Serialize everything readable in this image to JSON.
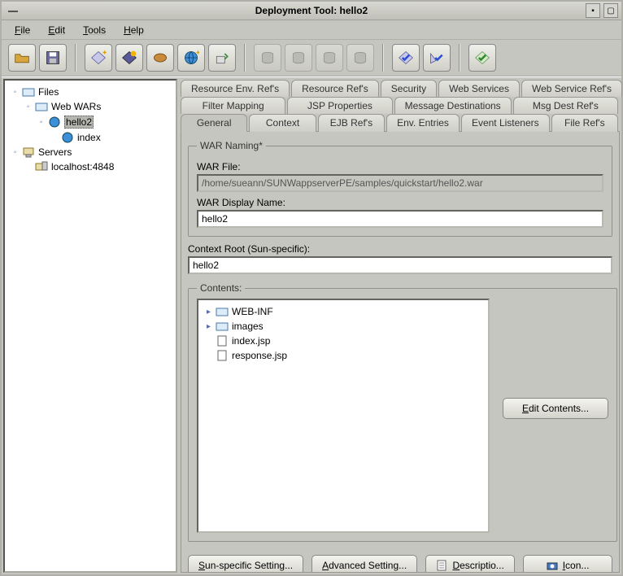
{
  "window": {
    "title": "Deployment Tool: hello2"
  },
  "menubar": {
    "items": [
      "File",
      "Edit",
      "Tools",
      "Help"
    ]
  },
  "toolbar": {
    "icons": [
      "open",
      "save",
      "add-simple",
      "add-sun",
      "bean",
      "globe-new",
      "retrieve",
      "db-box1",
      "db-box2",
      "db-box3",
      "db-box4",
      "check-blue1",
      "check-blue2",
      "check-green"
    ]
  },
  "tree": {
    "files": {
      "label": "Files",
      "web_wars": {
        "label": "Web WARs",
        "hello2": {
          "label": "hello2",
          "index": "index"
        }
      }
    },
    "servers": {
      "label": "Servers",
      "localhost": "localhost:4848"
    }
  },
  "tabs": {
    "row1": [
      "Resource Env. Ref's",
      "Resource Ref's",
      "Security",
      "Web Services",
      "Web Service Ref's"
    ],
    "row2": [
      "Filter Mapping",
      "JSP Properties",
      "Message Destinations",
      "Msg Dest Ref's"
    ],
    "row3": [
      "General",
      "Context",
      "EJB Ref's",
      "Env. Entries",
      "Event Listeners",
      "File Ref's"
    ]
  },
  "general": {
    "war_naming_legend": "WAR Naming*",
    "war_file_label": "WAR File:",
    "war_file_value": "/home/sueann/SUNWappserverPE/samples/quickstart/hello2.war",
    "war_display_name_label": "WAR Display Name:",
    "war_display_name_value": "hello2",
    "context_root_label": "Context Root (Sun-specific):",
    "context_root_value": "hello2",
    "contents_legend": "Contents:",
    "contents_tree": {
      "webinf": "WEB-INF",
      "images": "images",
      "indexjsp": "index.jsp",
      "responsejsp": "response.jsp"
    },
    "edit_contents": "Edit Contents..."
  },
  "bottom_buttons": {
    "sun_specific": "Sun-specific Setting...",
    "advanced": "Advanced Setting...",
    "description": "Descriptio...",
    "icon": "Icon..."
  }
}
